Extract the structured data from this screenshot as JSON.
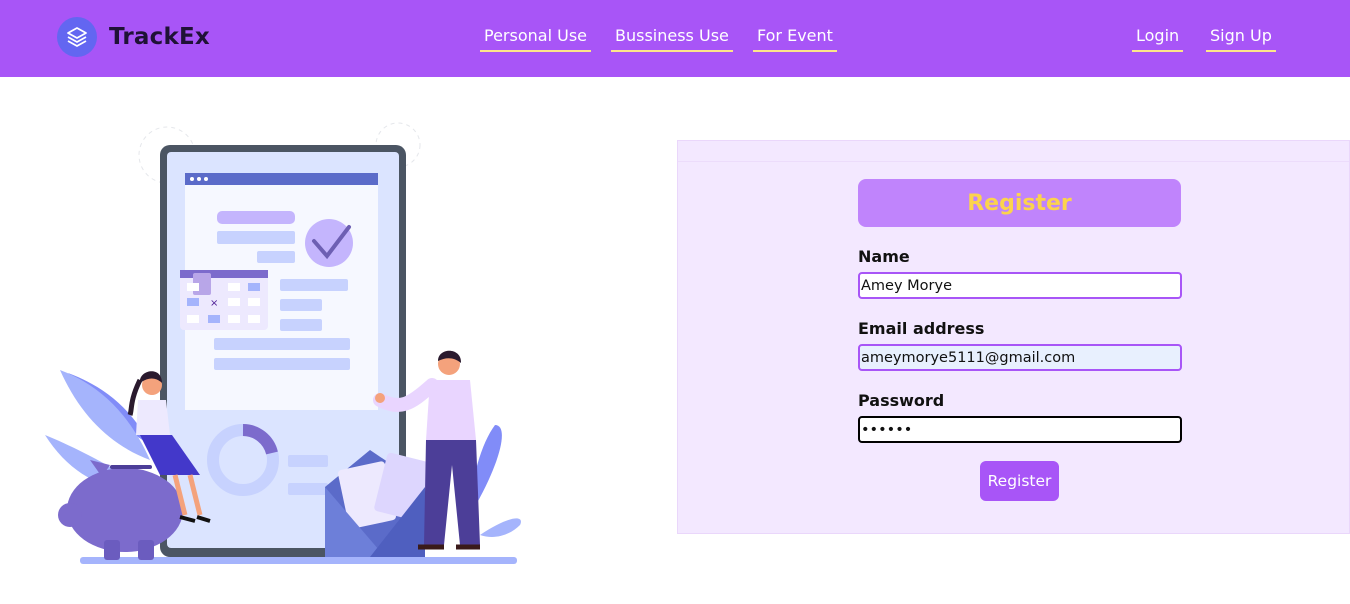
{
  "brand": {
    "name": "TrackEx",
    "logo_icon": "layers-icon"
  },
  "nav": {
    "center_links": [
      {
        "label": "Personal Use"
      },
      {
        "label": "Bussiness Use"
      },
      {
        "label": "For Event"
      }
    ],
    "auth_links": [
      {
        "label": "Login"
      },
      {
        "label": "Sign Up"
      }
    ]
  },
  "register_form": {
    "title": "Register",
    "fields": {
      "name": {
        "label": "Name",
        "value": "Amey Morye"
      },
      "email": {
        "label": "Email address",
        "value": "ameymorye5111@gmail.com"
      },
      "password": {
        "label": "Password",
        "value": "••••••"
      }
    },
    "submit_label": "Register"
  },
  "colors": {
    "navbar": "#a855f7",
    "accent_underline": "#fde68a",
    "panel_bg": "#f3e8ff",
    "header_bg": "#c084fc",
    "header_text": "#fcd34d",
    "logo_bg": "#6366f1"
  }
}
